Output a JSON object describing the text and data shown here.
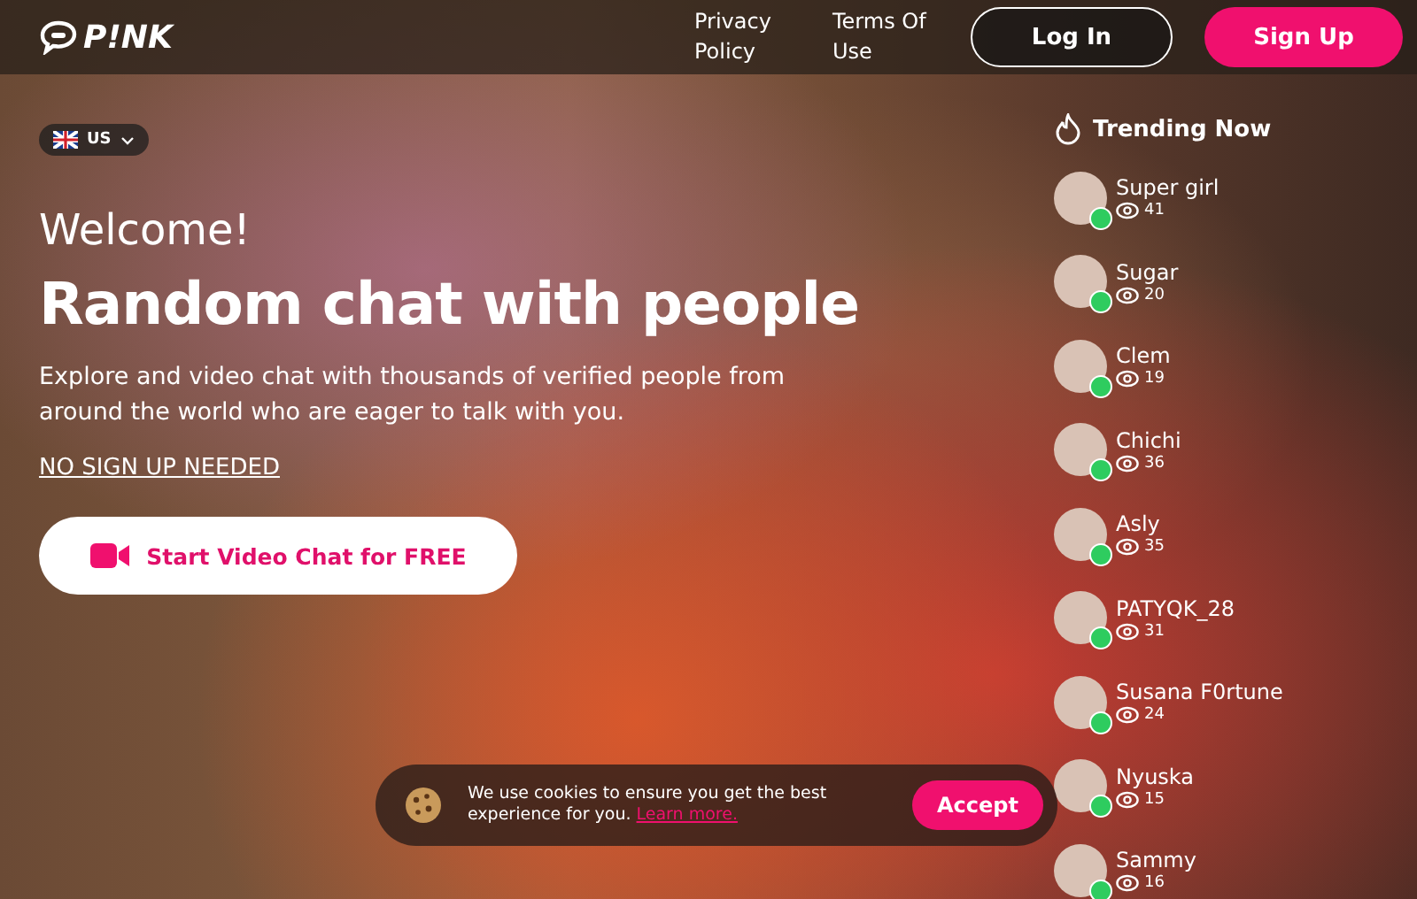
{
  "header": {
    "logo": "P!NK",
    "nav": [
      "Privacy Policy",
      "Terms Of Use"
    ],
    "login": "Log In",
    "signup": "Sign Up"
  },
  "language": {
    "label": "US"
  },
  "hero": {
    "welcome": "Welcome!",
    "headline": "Random chat with people",
    "description": "Explore and video chat with thousands of verified people from around the world who are eager to talk with you.",
    "link": "NO SIGN UP NEEDED",
    "cta": "Start Video Chat for FREE"
  },
  "trending": {
    "title": "Trending Now",
    "users": [
      {
        "name": "Super girl",
        "viewers": "41"
      },
      {
        "name": "Sugar",
        "viewers": "20"
      },
      {
        "name": "Clem",
        "viewers": "19"
      },
      {
        "name": "Chichi",
        "viewers": "36"
      },
      {
        "name": "Asly",
        "viewers": "35"
      },
      {
        "name": "PATYQK_28",
        "viewers": "31"
      },
      {
        "name": "Susana F0rtune",
        "viewers": "24"
      },
      {
        "name": "Nyuska",
        "viewers": "15"
      },
      {
        "name": "Sammy",
        "viewers": "16"
      }
    ]
  },
  "cookie": {
    "text": "We use cookies to ensure you get the best experience for you.",
    "link": "Learn more.",
    "accept": "Accept"
  }
}
